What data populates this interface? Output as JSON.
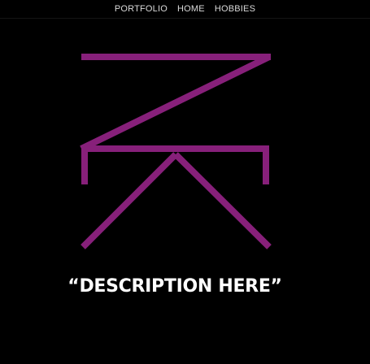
{
  "nav": {
    "items": [
      {
        "label": "PORTFOLIO"
      },
      {
        "label": "HOME"
      },
      {
        "label": "HOBBIES"
      }
    ]
  },
  "hero": {
    "tagline": "“DESCRIPTION HERE”"
  },
  "colors": {
    "background": "#000000",
    "logo_stroke": "#87207a",
    "nav_text": "#d9d9d9",
    "tagline_text": "#ffffff"
  },
  "icons": {
    "logo": "zk-monogram-logo"
  }
}
